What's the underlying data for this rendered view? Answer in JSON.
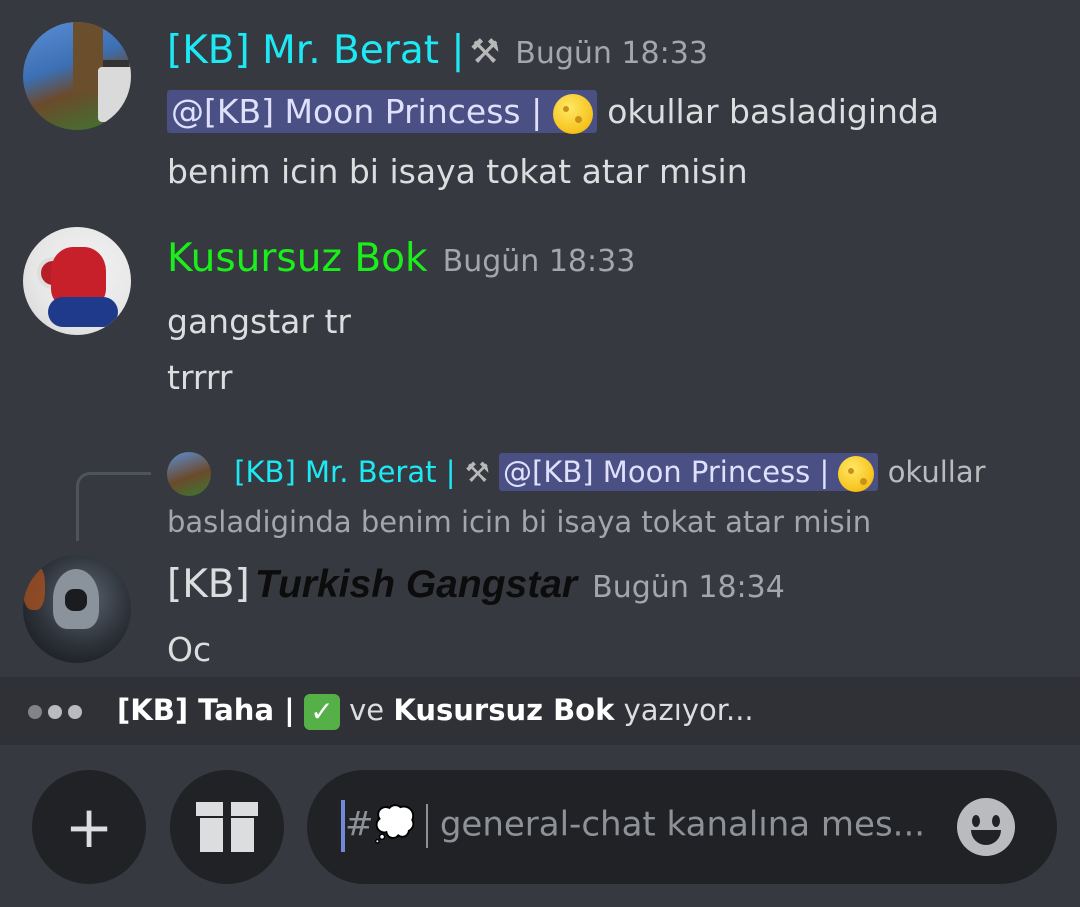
{
  "messages": [
    {
      "author": "[KB] Mr. Berat |",
      "author_color": "#1de9f5",
      "author_icon": "hammer-and-wrench-icon",
      "timestamp": "Bugün 18:33",
      "mention": "@[KB] Moon Princess |",
      "mention_icon": "moon-icon",
      "text_line1": "okullar basladiginda",
      "text_line2": "benim icin bi isaya tokat atar misin"
    },
    {
      "author": "Kusursuz Bok",
      "author_color": "#1bee1b",
      "timestamp": "Bugün 18:33",
      "lines": [
        "gangstar tr",
        "trrrr"
      ]
    },
    {
      "reply": {
        "author": "[KB] Mr. Berat |",
        "mention": "@[KB] Moon Princess |",
        "text_line1": "okullar",
        "text_line2": "basladiginda benim icin bi isaya tokat atar misin"
      },
      "author_prefix": "[KB]",
      "author_name": "Turkish Gangstar",
      "author_color": "#0c0c0c",
      "timestamp": "Bugün 18:34",
      "text": "Oc"
    }
  ],
  "typing": {
    "user1": "[KB] Taha |",
    "user1_icon": "check-mark-icon",
    "conjunction": "ve",
    "user2": "Kusursuz Bok",
    "suffix": "yazıyor..."
  },
  "composer": {
    "channel_prefix": "#💭",
    "placeholder": "general-chat kanalına mes..."
  }
}
